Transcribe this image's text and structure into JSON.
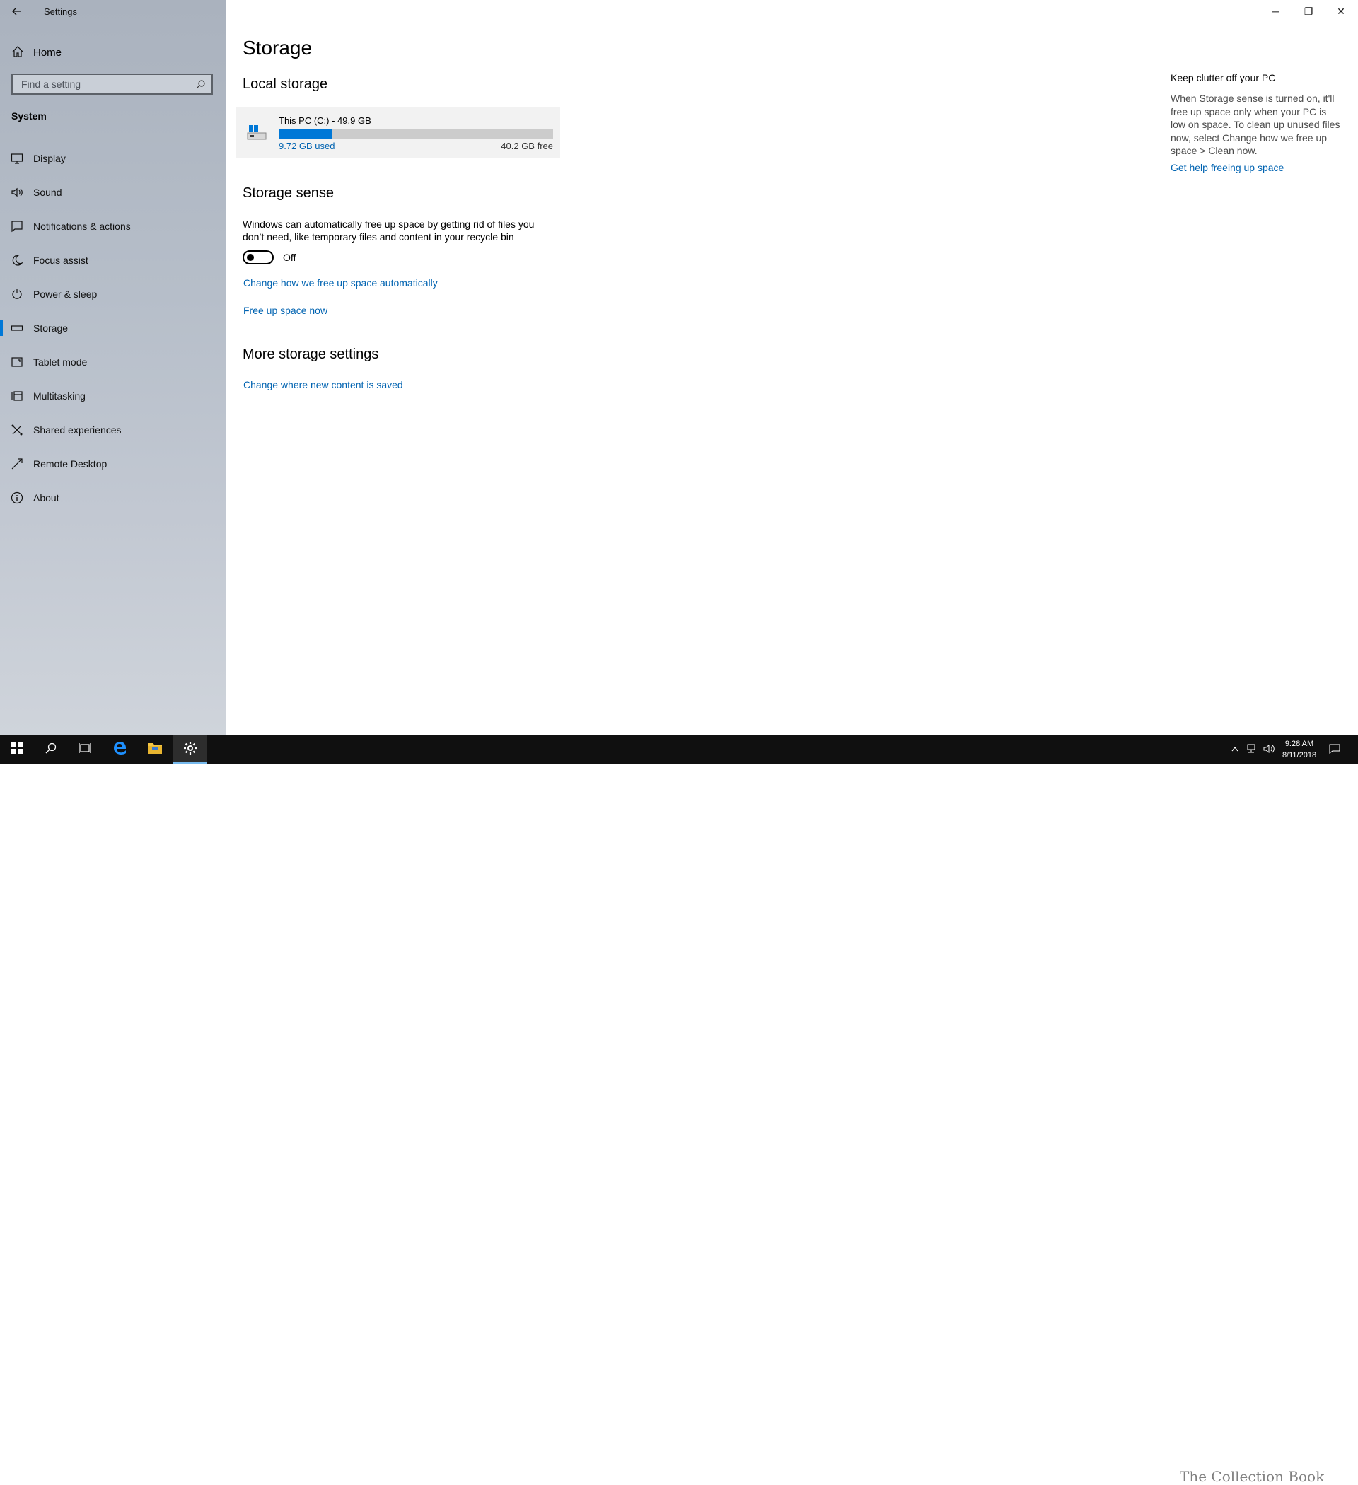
{
  "window": {
    "title": "Settings",
    "controls": {
      "minimize": "─",
      "restore": "❐",
      "close": "✕"
    }
  },
  "sidebar": {
    "home_label": "Home",
    "search_placeholder": "Find a setting",
    "section": "System",
    "items": [
      {
        "label": "Display",
        "icon": "display-icon"
      },
      {
        "label": "Sound",
        "icon": "sound-icon"
      },
      {
        "label": "Notifications & actions",
        "icon": "notifications-icon"
      },
      {
        "label": "Focus assist",
        "icon": "focus-assist-icon"
      },
      {
        "label": "Power & sleep",
        "icon": "power-icon"
      },
      {
        "label": "Storage",
        "icon": "storage-icon",
        "active": true
      },
      {
        "label": "Tablet mode",
        "icon": "tablet-mode-icon"
      },
      {
        "label": "Multitasking",
        "icon": "multitasking-icon"
      },
      {
        "label": "Shared experiences",
        "icon": "shared-experiences-icon"
      },
      {
        "label": "Remote Desktop",
        "icon": "remote-desktop-icon"
      },
      {
        "label": "About",
        "icon": "about-icon"
      }
    ]
  },
  "main": {
    "title": "Storage",
    "local_storage": {
      "heading": "Local storage",
      "drive_name": "This PC (C:) - 49.9 GB",
      "used_label": "9.72 GB used",
      "free_label": "40.2 GB free",
      "used_fraction": 0.195
    },
    "storage_sense": {
      "heading": "Storage sense",
      "description": "Windows can automatically free up space by getting rid of files you don’t need, like temporary files and content in your recycle bin",
      "toggle_state": "Off",
      "link_change": "Change how we free up space automatically",
      "link_free": "Free up space now"
    },
    "more_settings": {
      "heading": "More storage settings",
      "link_change_location": "Change where new content is saved"
    }
  },
  "aside": {
    "title": "Keep clutter off your PC",
    "text": "When Storage sense is turned on, it'll free up space only when your PC is low on space. To clean up unused files now, select Change how we free up space > Clean now.",
    "link": "Get help freeing up space"
  },
  "taskbar": {
    "time": "9:28 AM",
    "date": "8/11/2018",
    "watermark": "The Collection Book",
    "accent": "#0078d7"
  }
}
